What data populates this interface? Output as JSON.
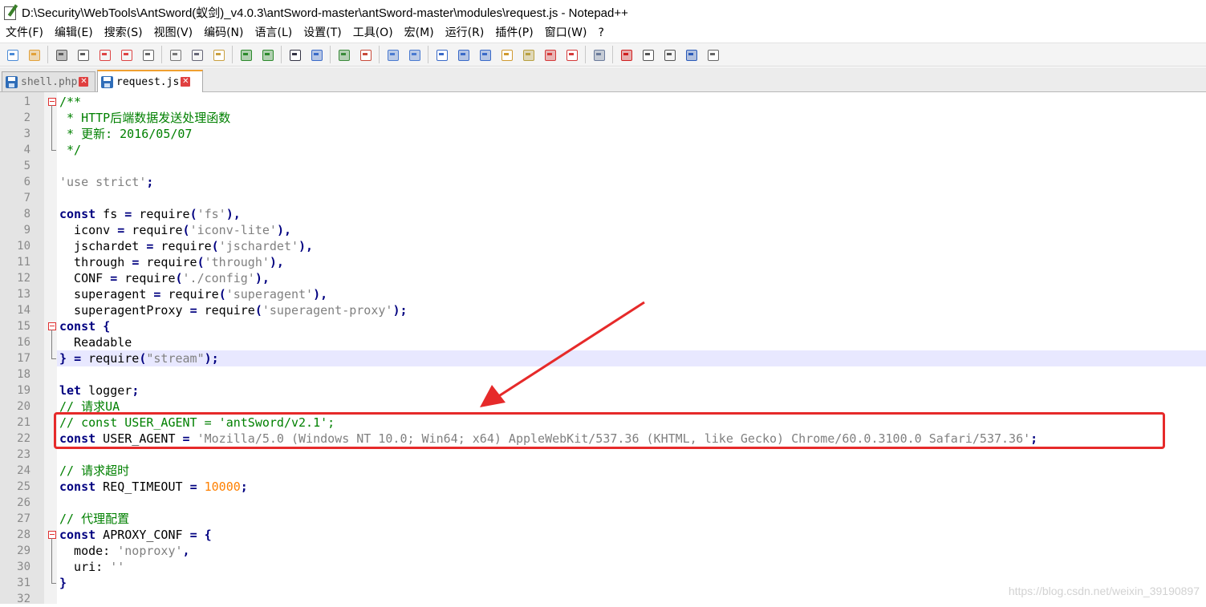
{
  "window": {
    "title": "D:\\Security\\WebTools\\AntSword(蚁剑)_v4.0.3\\antSword-master\\antSword-master\\modules\\request.js - Notepad++"
  },
  "menu": [
    "文件(F)",
    "编辑(E)",
    "搜索(S)",
    "视图(V)",
    "编码(N)",
    "语言(L)",
    "设置(T)",
    "工具(O)",
    "宏(M)",
    "运行(R)",
    "插件(P)",
    "窗口(W)",
    "?"
  ],
  "toolbar_icons": [
    "new-file-icon",
    "open-file-icon",
    "save-icon",
    "save-all-icon",
    "close-icon",
    "close-all-icon",
    "print-icon",
    "cut-icon",
    "copy-icon",
    "paste-icon",
    "undo-icon",
    "redo-icon",
    "find-icon",
    "replace-icon",
    "zoom-in-icon",
    "zoom-out-icon",
    "sync-vertical-icon",
    "sync-horizontal-icon",
    "word-wrap-icon",
    "show-all-chars-icon",
    "indent-guide-icon",
    "doc-map-icon",
    "function-list-icon",
    "folder-workspace-icon",
    "monitoring-icon",
    "eye-icon",
    "record-macro-icon",
    "stop-record-icon",
    "play-macro-icon",
    "run-macro-multiple-icon",
    "save-macro-icon"
  ],
  "tabs": [
    {
      "label": "shell.php",
      "active": false
    },
    {
      "label": "request.js",
      "active": true
    }
  ],
  "editor": {
    "lines": [
      {
        "n": "1",
        "tokens": [
          [
            "cm",
            "/**"
          ]
        ]
      },
      {
        "n": "2",
        "tokens": [
          [
            "cm",
            " * HTTP后端数据发送处理函数"
          ]
        ]
      },
      {
        "n": "3",
        "tokens": [
          [
            "cm",
            " * 更新: 2016/05/07"
          ]
        ]
      },
      {
        "n": "4",
        "tokens": [
          [
            "cm",
            " */"
          ]
        ]
      },
      {
        "n": "5",
        "tokens": []
      },
      {
        "n": "6",
        "tokens": [
          [
            "str",
            "'use strict'"
          ],
          [
            "op",
            ";"
          ]
        ]
      },
      {
        "n": "7",
        "tokens": []
      },
      {
        "n": "8",
        "tokens": [
          [
            "kw",
            "const"
          ],
          [
            "tx",
            " fs "
          ],
          [
            "op",
            "="
          ],
          [
            "tx",
            " require"
          ],
          [
            "op",
            "("
          ],
          [
            "str",
            "'fs'"
          ],
          [
            "op",
            "),"
          ]
        ]
      },
      {
        "n": "9",
        "tokens": [
          [
            "tx",
            "  iconv "
          ],
          [
            "op",
            "="
          ],
          [
            "tx",
            " require"
          ],
          [
            "op",
            "("
          ],
          [
            "str",
            "'iconv-lite'"
          ],
          [
            "op",
            "),"
          ]
        ]
      },
      {
        "n": "10",
        "tokens": [
          [
            "tx",
            "  jschardet "
          ],
          [
            "op",
            "="
          ],
          [
            "tx",
            " require"
          ],
          [
            "op",
            "("
          ],
          [
            "str",
            "'jschardet'"
          ],
          [
            "op",
            "),"
          ]
        ]
      },
      {
        "n": "11",
        "tokens": [
          [
            "tx",
            "  through "
          ],
          [
            "op",
            "="
          ],
          [
            "tx",
            " require"
          ],
          [
            "op",
            "("
          ],
          [
            "str",
            "'through'"
          ],
          [
            "op",
            "),"
          ]
        ]
      },
      {
        "n": "12",
        "tokens": [
          [
            "tx",
            "  CONF "
          ],
          [
            "op",
            "="
          ],
          [
            "tx",
            " require"
          ],
          [
            "op",
            "("
          ],
          [
            "str",
            "'./config'"
          ],
          [
            "op",
            "),"
          ]
        ]
      },
      {
        "n": "13",
        "tokens": [
          [
            "tx",
            "  superagent "
          ],
          [
            "op",
            "="
          ],
          [
            "tx",
            " require"
          ],
          [
            "op",
            "("
          ],
          [
            "str",
            "'superagent'"
          ],
          [
            "op",
            "),"
          ]
        ]
      },
      {
        "n": "14",
        "tokens": [
          [
            "tx",
            "  superagentProxy "
          ],
          [
            "op",
            "="
          ],
          [
            "tx",
            " require"
          ],
          [
            "op",
            "("
          ],
          [
            "str",
            "'superagent-proxy'"
          ],
          [
            "op",
            ");"
          ]
        ]
      },
      {
        "n": "15",
        "tokens": [
          [
            "kw",
            "const"
          ],
          [
            "tx",
            " "
          ],
          [
            "op",
            "{"
          ]
        ]
      },
      {
        "n": "16",
        "tokens": [
          [
            "tx",
            "  Readable"
          ]
        ]
      },
      {
        "n": "17",
        "tokens": [
          [
            "op",
            "}"
          ],
          [
            "tx",
            " "
          ],
          [
            "op",
            "="
          ],
          [
            "tx",
            " require"
          ],
          [
            "op",
            "("
          ],
          [
            "str",
            "\"stream\""
          ],
          [
            "op",
            ");"
          ]
        ]
      },
      {
        "n": "18",
        "tokens": []
      },
      {
        "n": "19",
        "tokens": [
          [
            "kw",
            "let"
          ],
          [
            "tx",
            " logger"
          ],
          [
            "op",
            ";"
          ]
        ]
      },
      {
        "n": "20",
        "tokens": [
          [
            "cm",
            "// 请求UA"
          ]
        ]
      },
      {
        "n": "21",
        "tokens": [
          [
            "cm",
            "// const USER_AGENT = 'antSword/v2.1';"
          ]
        ]
      },
      {
        "n": "22",
        "tokens": [
          [
            "kw",
            "const"
          ],
          [
            "tx",
            " USER_AGENT "
          ],
          [
            "op",
            "="
          ],
          [
            "tx",
            " "
          ],
          [
            "str",
            "'Mozilla/5.0 (Windows NT 10.0; Win64; x64) AppleWebKit/537.36 (KHTML, like Gecko) Chrome/60.0.3100.0 Safari/537.36'"
          ],
          [
            "op",
            ";"
          ]
        ]
      },
      {
        "n": "23",
        "tokens": []
      },
      {
        "n": "24",
        "tokens": [
          [
            "cm",
            "// 请求超时"
          ]
        ]
      },
      {
        "n": "25",
        "tokens": [
          [
            "kw",
            "const"
          ],
          [
            "tx",
            " REQ_TIMEOUT "
          ],
          [
            "op",
            "="
          ],
          [
            "tx",
            " "
          ],
          [
            "num",
            "10000"
          ],
          [
            "op",
            ";"
          ]
        ]
      },
      {
        "n": "26",
        "tokens": []
      },
      {
        "n": "27",
        "tokens": [
          [
            "cm",
            "// 代理配置"
          ]
        ]
      },
      {
        "n": "28",
        "tokens": [
          [
            "kw",
            "const"
          ],
          [
            "tx",
            " APROXY_CONF "
          ],
          [
            "op",
            "="
          ],
          [
            "tx",
            " "
          ],
          [
            "op",
            "{"
          ]
        ]
      },
      {
        "n": "29",
        "tokens": [
          [
            "tx",
            "  mode: "
          ],
          [
            "str",
            "'noproxy'"
          ],
          [
            "op",
            ","
          ]
        ]
      },
      {
        "n": "30",
        "tokens": [
          [
            "tx",
            "  uri: "
          ],
          [
            "str",
            "''"
          ]
        ]
      },
      {
        "n": "31",
        "tokens": [
          [
            "op",
            "}"
          ]
        ]
      },
      {
        "n": "32",
        "tokens": []
      }
    ],
    "current_line": "17"
  },
  "annotation": {
    "color": "#e62a2a"
  },
  "watermark": "https://blog.csdn.net/weixin_39190897"
}
